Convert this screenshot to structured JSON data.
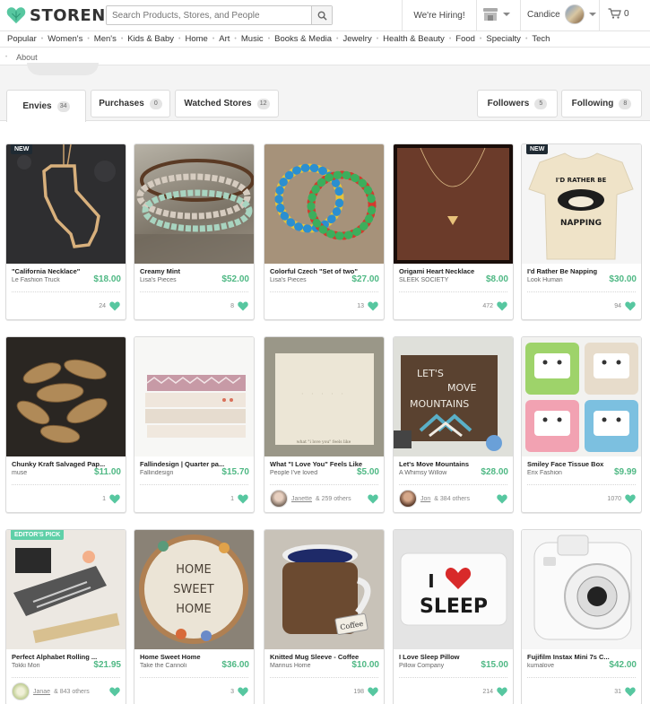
{
  "header": {
    "logo_text": "STORENVY",
    "search_placeholder": "Search Products, Stores, and People",
    "hiring": "We're Hiring!",
    "user_name": "Candice",
    "cart_count": "0"
  },
  "categories": [
    "Popular",
    "Women's",
    "Men's",
    "Kids & Baby",
    "Home",
    "Art",
    "Music",
    "Books & Media",
    "Jewelry",
    "Health & Beauty",
    "Food",
    "Specialty",
    "Tech"
  ],
  "about": "About",
  "tabs": {
    "envies": {
      "label": "Envies",
      "count": "34"
    },
    "purchases": {
      "label": "Purchases",
      "count": "0"
    },
    "watched": {
      "label": "Watched Stores",
      "count": "12"
    },
    "followers": {
      "label": "Followers",
      "count": "5"
    },
    "following": {
      "label": "Following",
      "count": "8"
    }
  },
  "products": [
    {
      "name": "\"California Necklace\"",
      "store": "Le Fashion Truck",
      "price": "$18.00",
      "envies": "24",
      "badge": "NEW"
    },
    {
      "name": "Creamy Mint",
      "store": "Lisa's Pieces",
      "price": "$52.00",
      "envies": "8"
    },
    {
      "name": "Colorful Czech \"Set of two\"",
      "store": "Lisa's Pieces",
      "price": "$27.00",
      "envies": "13"
    },
    {
      "name": "Origami Heart Necklace",
      "store": "SLEEK SOCIETY",
      "price": "$8.00",
      "envies": "472"
    },
    {
      "name": "I'd Rather Be Napping",
      "store": "Look Human",
      "price": "$30.00",
      "envies": "94",
      "badge": "NEW"
    },
    {
      "name": "Chunky Kraft Salvaged Pap...",
      "store": "muse",
      "price": "$11.00",
      "envies": "1"
    },
    {
      "name": "Fallindesign | Quarter pa...",
      "store": "Fallindesign",
      "price": "$15.70",
      "envies": "1"
    },
    {
      "name": "What \"I Love You\" Feels Like",
      "store": "People I've loved",
      "price": "$5.00",
      "envies_user": "Janette",
      "envies_rest": "& 259 others"
    },
    {
      "name": "Let's Move Mountains",
      "store": "A Whimsy Willow",
      "price": "$28.00",
      "envies_user": "Jon",
      "envies_rest": "& 384 others"
    },
    {
      "name": "Smiley Face Tissue Box",
      "store": "Erix Fashion",
      "price": "$9.99",
      "envies": "1070"
    },
    {
      "name": "Perfect Alphabet Rolling ...",
      "store": "Tokki Mori",
      "price": "$21.95",
      "envies_user": "Janae",
      "envies_rest": "& 843 others",
      "badge": "EDITOR'S PICK"
    },
    {
      "name": "Home Sweet Home",
      "store": "Take the Cannoli",
      "price": "$36.00",
      "envies": "3"
    },
    {
      "name": "Knitted Mug Sleeve - Coffee",
      "store": "Marinus Home",
      "price": "$10.00",
      "envies": "198"
    },
    {
      "name": "I Love Sleep Pillow",
      "store": "Pillow Company",
      "price": "$15.00",
      "envies": "214"
    },
    {
      "name": "Fujifilm Instax Mini 7s C...",
      "store": "kumalove",
      "price": "$42.00",
      "envies": "31"
    }
  ],
  "image_text": {
    "tshirt_top": "I'D RATHER BE",
    "tshirt_bottom": "NAPPING",
    "card_text": "what \"i love you\" feels like",
    "sign_line1": "LET'S",
    "sign_line2": "MOVE",
    "sign_line3": "MOUNTAINS",
    "hoop_line1": "HOME",
    "hoop_line2": "SWEET",
    "hoop_line3": "HOME",
    "mug_tag": "Coffee",
    "pillow_top": "I",
    "pillow_bottom": "SLEEP"
  },
  "colors": {
    "accent": "#4fb884",
    "brand_heart": "#57c7a0"
  }
}
